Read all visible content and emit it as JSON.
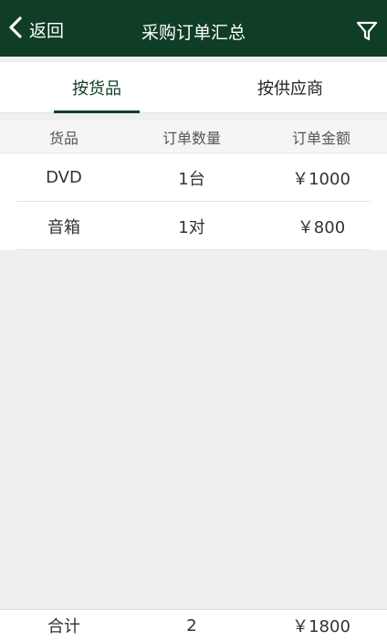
{
  "header": {
    "back_label": "返回",
    "title": "采购订单汇总",
    "back_icon": "chevron-left-icon",
    "filter_icon": "filter-icon",
    "background": "#0f3d25"
  },
  "tabs": [
    {
      "label": "按货品",
      "active": true
    },
    {
      "label": "按供应商",
      "active": false
    }
  ],
  "table": {
    "columns": [
      "货品",
      "订单数量",
      "订单金额"
    ],
    "rows": [
      {
        "item": "DVD",
        "quantity": "1台",
        "amount": "￥1000"
      },
      {
        "item": "音箱",
        "quantity": "1对",
        "amount": "￥800"
      }
    ]
  },
  "footer": {
    "label": "合计",
    "total_quantity": "2",
    "total_amount": "￥1800"
  }
}
